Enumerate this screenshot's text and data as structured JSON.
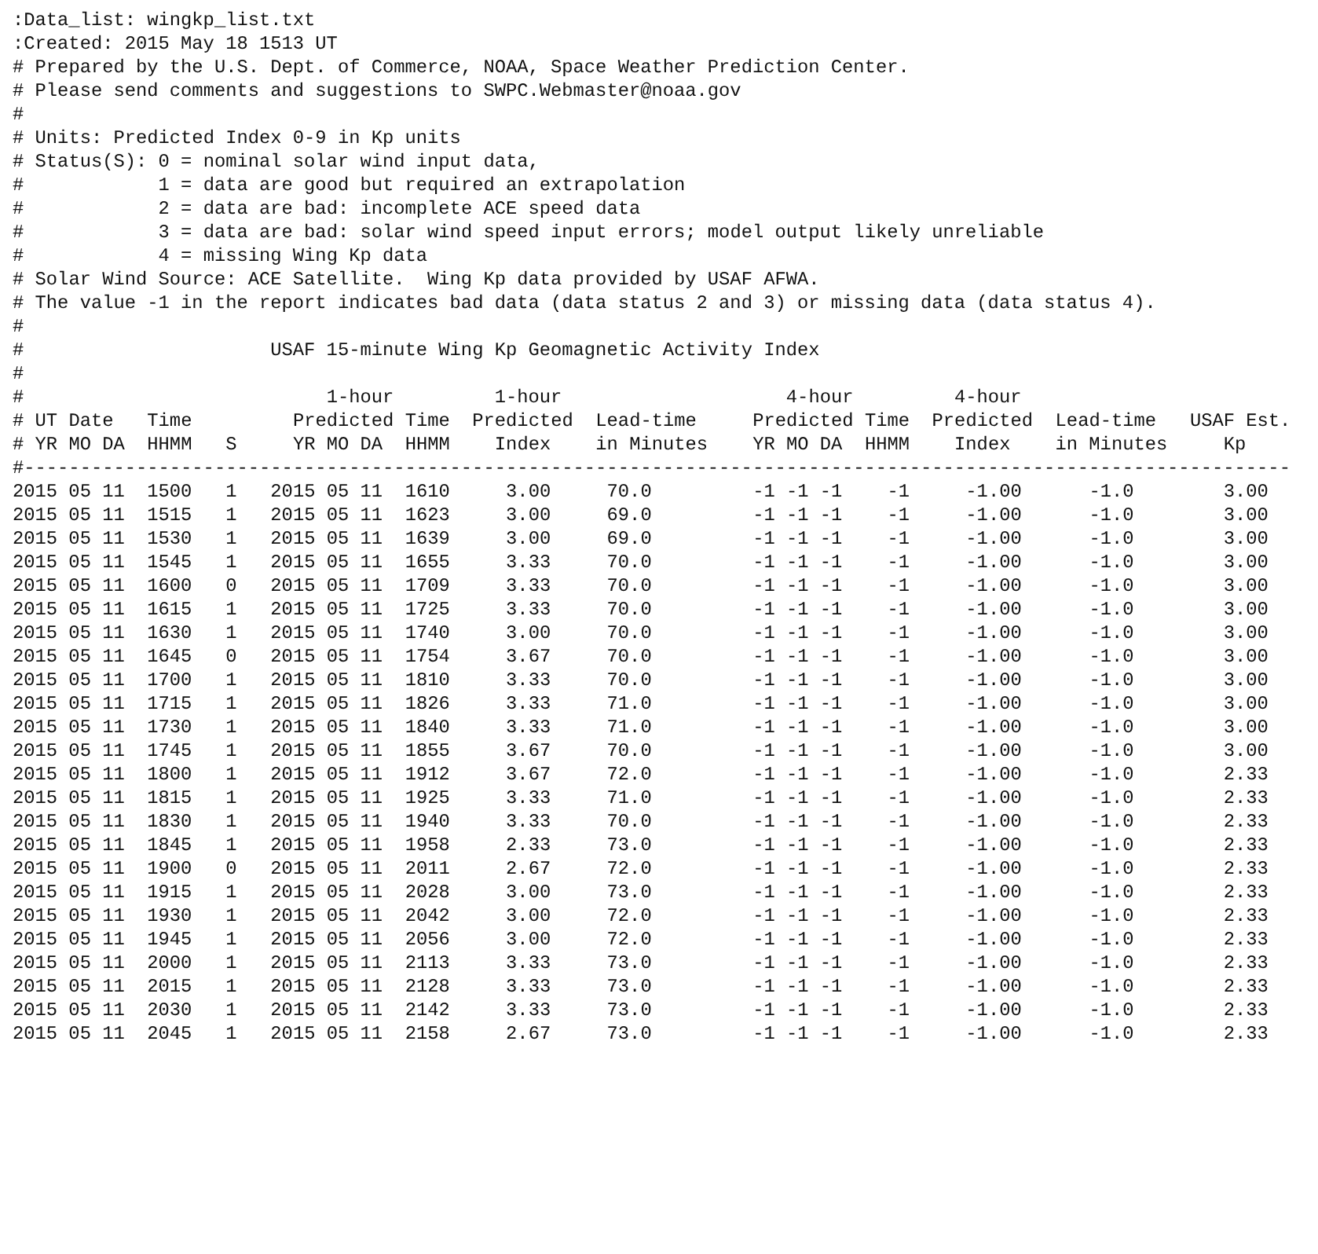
{
  "preamble": [
    {
      "kind": "plain",
      "text": ":Data_list: wingkp_list.txt"
    },
    {
      "kind": "plain",
      "text": ":Created: 2015 May 18 1513 UT"
    },
    {
      "kind": "comment",
      "marker": "#",
      "text": "Prepared by the U.S. Dept. of Commerce, NOAA, Space Weather Prediction Center."
    },
    {
      "kind": "comment",
      "marker": "#",
      "text": "Please send comments and suggestions to SWPC.Webmaster@noaa.gov"
    },
    {
      "kind": "comment",
      "marker": "#"
    },
    {
      "kind": "comment",
      "marker": "#",
      "text": "Units: Predicted Index 0-9 in Kp units"
    },
    {
      "kind": "comment",
      "marker": "#",
      "text": "Status(S): 0 = nominal solar wind input data,"
    },
    {
      "kind": "status",
      "marker": "#",
      "text": "1 = data are good but required an extrapolation"
    },
    {
      "kind": "status",
      "marker": "#",
      "text": "2 = data are bad: incomplete ACE speed data"
    },
    {
      "kind": "status",
      "marker": "#",
      "text": "3 = data are bad: solar wind speed input errors; model output likely unreliable"
    },
    {
      "kind": "status",
      "marker": "#",
      "text": "4 = missing Wing Kp data"
    },
    {
      "kind": "comment",
      "marker": "#",
      "text": "Solar Wind Source: ACE Satellite.  Wing Kp data provided by USAF AFWA."
    },
    {
      "kind": "comment",
      "marker": "#",
      "text": "The value -1 in the report indicates bad data (data status 2 and 3) or missing data (data status 4)."
    },
    {
      "kind": "comment",
      "marker": "#"
    },
    {
      "kind": "title",
      "marker": "#",
      "text": "USAF 15-minute Wing Kp Geomagnetic Activity Index"
    },
    {
      "kind": "comment",
      "marker": "#"
    }
  ],
  "column_header_lines": [
    [
      "#",
      "1-hour",
      "1-hour",
      "4-hour",
      "4-hour"
    ],
    [
      "#",
      "UT Date",
      "Time",
      "Predicted",
      "Time",
      "Predicted",
      "Lead-time",
      "Predicted",
      "Time",
      "Predicted",
      "Lead-time",
      "USAF Est."
    ],
    [
      "#",
      "YR MO DA",
      "HHMM",
      "S",
      "YR MO DA",
      "HHMM",
      "Index",
      "in Minutes",
      "YR MO DA",
      "HHMM",
      "Index",
      "in Minutes",
      "Kp"
    ]
  ],
  "separator": "#-----------------------------------------------------------------------------------------------------------------",
  "rows": [
    [
      "2015 05 11",
      "1500",
      "1",
      "2015 05 11",
      "1610",
      "3.00",
      "70.0",
      "-1 -1 -1",
      "-1",
      "-1.00",
      "-1.0",
      "3.00"
    ],
    [
      "2015 05 11",
      "1515",
      "1",
      "2015 05 11",
      "1623",
      "3.00",
      "69.0",
      "-1 -1 -1",
      "-1",
      "-1.00",
      "-1.0",
      "3.00"
    ],
    [
      "2015 05 11",
      "1530",
      "1",
      "2015 05 11",
      "1639",
      "3.00",
      "69.0",
      "-1 -1 -1",
      "-1",
      "-1.00",
      "-1.0",
      "3.00"
    ],
    [
      "2015 05 11",
      "1545",
      "1",
      "2015 05 11",
      "1655",
      "3.33",
      "70.0",
      "-1 -1 -1",
      "-1",
      "-1.00",
      "-1.0",
      "3.00"
    ],
    [
      "2015 05 11",
      "1600",
      "0",
      "2015 05 11",
      "1709",
      "3.33",
      "70.0",
      "-1 -1 -1",
      "-1",
      "-1.00",
      "-1.0",
      "3.00"
    ],
    [
      "2015 05 11",
      "1615",
      "1",
      "2015 05 11",
      "1725",
      "3.33",
      "70.0",
      "-1 -1 -1",
      "-1",
      "-1.00",
      "-1.0",
      "3.00"
    ],
    [
      "2015 05 11",
      "1630",
      "1",
      "2015 05 11",
      "1740",
      "3.00",
      "70.0",
      "-1 -1 -1",
      "-1",
      "-1.00",
      "-1.0",
      "3.00"
    ],
    [
      "2015 05 11",
      "1645",
      "0",
      "2015 05 11",
      "1754",
      "3.67",
      "70.0",
      "-1 -1 -1",
      "-1",
      "-1.00",
      "-1.0",
      "3.00"
    ],
    [
      "2015 05 11",
      "1700",
      "1",
      "2015 05 11",
      "1810",
      "3.33",
      "70.0",
      "-1 -1 -1",
      "-1",
      "-1.00",
      "-1.0",
      "3.00"
    ],
    [
      "2015 05 11",
      "1715",
      "1",
      "2015 05 11",
      "1826",
      "3.33",
      "71.0",
      "-1 -1 -1",
      "-1",
      "-1.00",
      "-1.0",
      "3.00"
    ],
    [
      "2015 05 11",
      "1730",
      "1",
      "2015 05 11",
      "1840",
      "3.33",
      "71.0",
      "-1 -1 -1",
      "-1",
      "-1.00",
      "-1.0",
      "3.00"
    ],
    [
      "2015 05 11",
      "1745",
      "1",
      "2015 05 11",
      "1855",
      "3.67",
      "70.0",
      "-1 -1 -1",
      "-1",
      "-1.00",
      "-1.0",
      "3.00"
    ],
    [
      "2015 05 11",
      "1800",
      "1",
      "2015 05 11",
      "1912",
      "3.67",
      "72.0",
      "-1 -1 -1",
      "-1",
      "-1.00",
      "-1.0",
      "2.33"
    ],
    [
      "2015 05 11",
      "1815",
      "1",
      "2015 05 11",
      "1925",
      "3.33",
      "71.0",
      "-1 -1 -1",
      "-1",
      "-1.00",
      "-1.0",
      "2.33"
    ],
    [
      "2015 05 11",
      "1830",
      "1",
      "2015 05 11",
      "1940",
      "3.33",
      "70.0",
      "-1 -1 -1",
      "-1",
      "-1.00",
      "-1.0",
      "2.33"
    ],
    [
      "2015 05 11",
      "1845",
      "1",
      "2015 05 11",
      "1958",
      "2.33",
      "73.0",
      "-1 -1 -1",
      "-1",
      "-1.00",
      "-1.0",
      "2.33"
    ],
    [
      "2015 05 11",
      "1900",
      "0",
      "2015 05 11",
      "2011",
      "2.67",
      "72.0",
      "-1 -1 -1",
      "-1",
      "-1.00",
      "-1.0",
      "2.33"
    ],
    [
      "2015 05 11",
      "1915",
      "1",
      "2015 05 11",
      "2028",
      "3.00",
      "73.0",
      "-1 -1 -1",
      "-1",
      "-1.00",
      "-1.0",
      "2.33"
    ],
    [
      "2015 05 11",
      "1930",
      "1",
      "2015 05 11",
      "2042",
      "3.00",
      "72.0",
      "-1 -1 -1",
      "-1",
      "-1.00",
      "-1.0",
      "2.33"
    ],
    [
      "2015 05 11",
      "1945",
      "1",
      "2015 05 11",
      "2056",
      "3.00",
      "72.0",
      "-1 -1 -1",
      "-1",
      "-1.00",
      "-1.0",
      "2.33"
    ],
    [
      "2015 05 11",
      "2000",
      "1",
      "2015 05 11",
      "2113",
      "3.33",
      "73.0",
      "-1 -1 -1",
      "-1",
      "-1.00",
      "-1.0",
      "2.33"
    ],
    [
      "2015 05 11",
      "2015",
      "1",
      "2015 05 11",
      "2128",
      "3.33",
      "73.0",
      "-1 -1 -1",
      "-1",
      "-1.00",
      "-1.0",
      "2.33"
    ],
    [
      "2015 05 11",
      "2030",
      "1",
      "2015 05 11",
      "2142",
      "3.33",
      "73.0",
      "-1 -1 -1",
      "-1",
      "-1.00",
      "-1.0",
      "2.33"
    ],
    [
      "2015 05 11",
      "2045",
      "1",
      "2015 05 11",
      "2158",
      "2.67",
      "73.0",
      "-1 -1 -1",
      "-1",
      "-1.00",
      "-1.0",
      "2.33"
    ]
  ]
}
